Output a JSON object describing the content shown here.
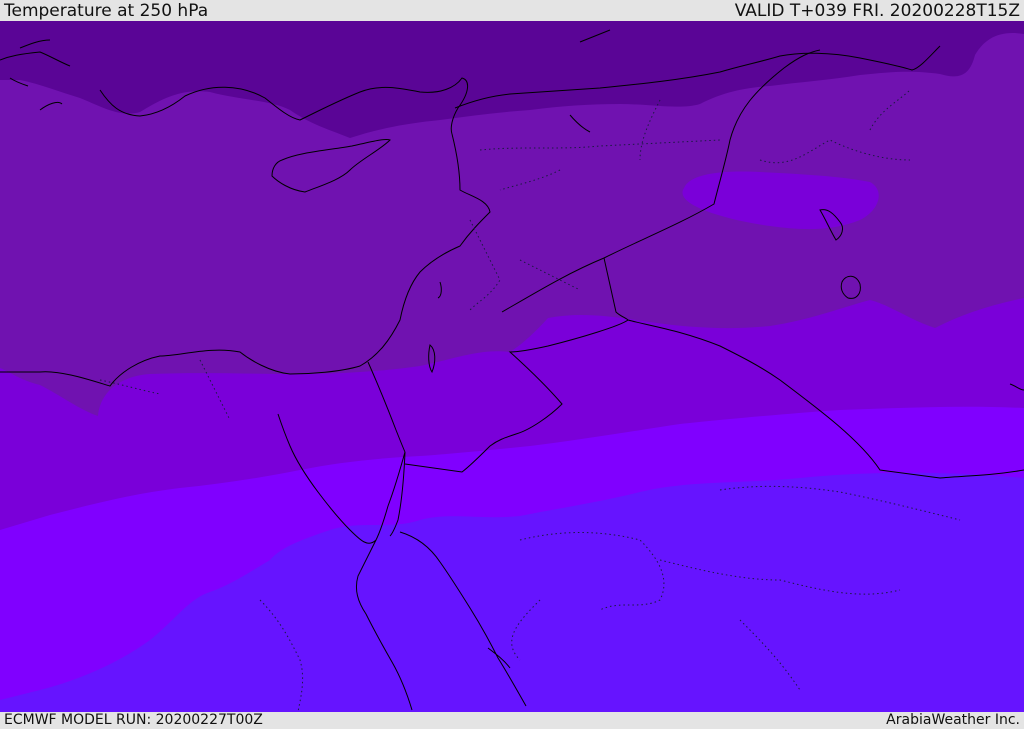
{
  "header": {
    "title": "Temperature at 250 hPa",
    "valid_time": "VALID T+039 FRI. 20200228T15Z"
  },
  "footer": {
    "model_run": "ECMWF MODEL RUN: 20200227T00Z",
    "credit": "ArabiaWeather Inc."
  },
  "map": {
    "field": "temperature",
    "level": "250 hPa",
    "colors": {
      "band_coldest": "#5a0596",
      "band_cold": "#7012b0",
      "band_cool": "#7a00d9",
      "band_mid": "#8000ff",
      "band_warm": "#6614ff",
      "coastline": "#000000",
      "border_dotted": "#1a1a40"
    }
  }
}
